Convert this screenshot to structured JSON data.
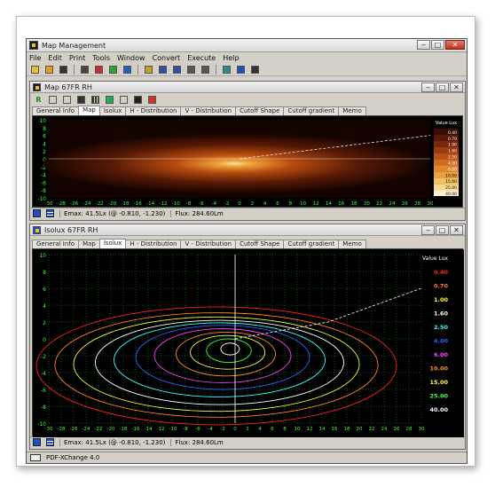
{
  "app": {
    "title": "Map Management"
  },
  "menu": [
    "File",
    "Edit",
    "Print",
    "Tools",
    "Window",
    "Convert",
    "Execute",
    "Help"
  ],
  "toolbar": {
    "icons": [
      "new-icon",
      "open-icon",
      "cut-icon",
      "calc-icon",
      "chart-icon",
      "color-map-icon",
      "export-icon",
      "folder-icon",
      "disk-icon",
      "save-icon",
      "print-preview-icon",
      "print-icon",
      "measure-icon",
      "map-view-icon",
      "info-icon"
    ]
  },
  "map_window": {
    "title": "Map 67FR RH",
    "tabs": [
      "General Info",
      "Map",
      "Isolux",
      "H - Distribution",
      "V - Distribution",
      "Cutoff Shape",
      "Cutoff gradient",
      "Memo"
    ],
    "active_tab": 1,
    "legend_title": "Value Lux",
    "status": {
      "emax": "Emax: 41.5Lx (@ -0.810, -1.230)",
      "flux": "Flux: 284.60Lm"
    }
  },
  "isolux_window": {
    "title": "Isolux 67FR RH",
    "tabs": [
      "General Info",
      "Map",
      "Isolux",
      "H - Distribution",
      "V - Distribution",
      "Cutoff Shape",
      "Cutoff gradient",
      "Memo"
    ],
    "active_tab": 2,
    "legend_title": "Value Lux",
    "legend": [
      {
        "label": "0.40",
        "color": "#ff2020"
      },
      {
        "label": "0.70",
        "color": "#ff8020"
      },
      {
        "label": "1.00",
        "color": "#ffff30"
      },
      {
        "label": "1.60",
        "color": "#ffffff"
      },
      {
        "label": "2.50",
        "color": "#30ffff"
      },
      {
        "label": "4.00",
        "color": "#3060ff"
      },
      {
        "label": "6.00",
        "color": "#ff40ff"
      },
      {
        "label": "10.00",
        "color": "#ff9020"
      },
      {
        "label": "15.00",
        "color": "#ffff40"
      },
      {
        "label": "25.00",
        "color": "#40ff40"
      },
      {
        "label": "40.00",
        "color": "#ffffff"
      }
    ],
    "status": {
      "emax": "Emax: 41.5Lx (@ -0.810, -1.230)",
      "flux": "Flux: 284.60Lm"
    }
  },
  "chart_data": [
    {
      "type": "heatmap",
      "title": "Map",
      "x_ticks": [
        -30,
        -28,
        -26,
        -24,
        -22,
        -20,
        -18,
        -16,
        -14,
        -12,
        -10,
        -8,
        -6,
        -4,
        -2,
        0,
        2,
        4,
        6,
        8,
        10,
        12,
        14,
        16,
        18,
        20,
        22,
        24,
        26,
        28,
        30
      ],
      "y_ticks": [
        10,
        8,
        6,
        4,
        2,
        0,
        -2,
        -4,
        -6,
        -8,
        -10
      ],
      "xlim": [
        -30,
        30
      ],
      "ylim": [
        -10,
        10
      ],
      "peak": {
        "x": -0.81,
        "y": -1.23,
        "value": 41.5
      },
      "scale_labels": [
        "0.40",
        "0.70",
        "1.00",
        "1.60",
        "2.50",
        "4.00",
        "6.00",
        "10.00",
        "15.00",
        "25.00",
        "40.00"
      ]
    },
    {
      "type": "line",
      "title": "Isolux",
      "x_ticks": [
        -30,
        -28,
        -26,
        -24,
        -22,
        -20,
        -18,
        -16,
        -14,
        -12,
        -10,
        -8,
        -6,
        -4,
        -2,
        0,
        2,
        4,
        6,
        8,
        10,
        12,
        14,
        16,
        18,
        20,
        22,
        24,
        26,
        28,
        30
      ],
      "y_ticks": [
        10,
        8,
        6,
        4,
        2,
        0,
        -2,
        -4,
        -6,
        -8,
        -10
      ],
      "xlim": [
        -30,
        30
      ],
      "ylim": [
        -10,
        10
      ],
      "cutoff_line": [
        [
          0,
          0
        ],
        [
          15,
          2
        ],
        [
          30,
          6
        ]
      ],
      "contours": [
        {
          "level": 0.4,
          "color": "#ff2020",
          "rx": 29,
          "ry": 7.0,
          "cx": -3,
          "cy": -3.2
        },
        {
          "level": 0.7,
          "color": "#ff8020",
          "rx": 26,
          "ry": 6.2,
          "cx": -3,
          "cy": -3.1
        },
        {
          "level": 1.0,
          "color": "#ffff30",
          "rx": 23,
          "ry": 5.6,
          "cx": -3,
          "cy": -3.0
        },
        {
          "level": 1.6,
          "color": "#ffffff",
          "rx": 20,
          "ry": 5.0,
          "cx": -2.5,
          "cy": -2.8
        },
        {
          "level": 2.5,
          "color": "#30ffff",
          "rx": 17,
          "ry": 4.4,
          "cx": -2.5,
          "cy": -2.5
        },
        {
          "level": 4.0,
          "color": "#3060ff",
          "rx": 14,
          "ry": 3.8,
          "cx": -2,
          "cy": -2.2
        },
        {
          "level": 6.0,
          "color": "#ff40ff",
          "rx": 11,
          "ry": 3.2,
          "cx": -2,
          "cy": -2.0
        },
        {
          "level": 10.0,
          "color": "#ff9020",
          "rx": 8,
          "ry": 2.6,
          "cx": -1.5,
          "cy": -1.8
        },
        {
          "level": 15.0,
          "color": "#ffff40",
          "rx": 6,
          "ry": 2.0,
          "cx": -1.2,
          "cy": -1.6
        },
        {
          "level": 25.0,
          "color": "#40ff40",
          "rx": 3.6,
          "ry": 1.4,
          "cx": -1,
          "cy": -1.4
        },
        {
          "level": 40.0,
          "color": "#ffffff",
          "rx": 1.5,
          "ry": 0.7,
          "cx": -0.8,
          "cy": -1.2
        }
      ]
    }
  ],
  "taskbar": {
    "label": "PDF-XChange 4.0"
  }
}
